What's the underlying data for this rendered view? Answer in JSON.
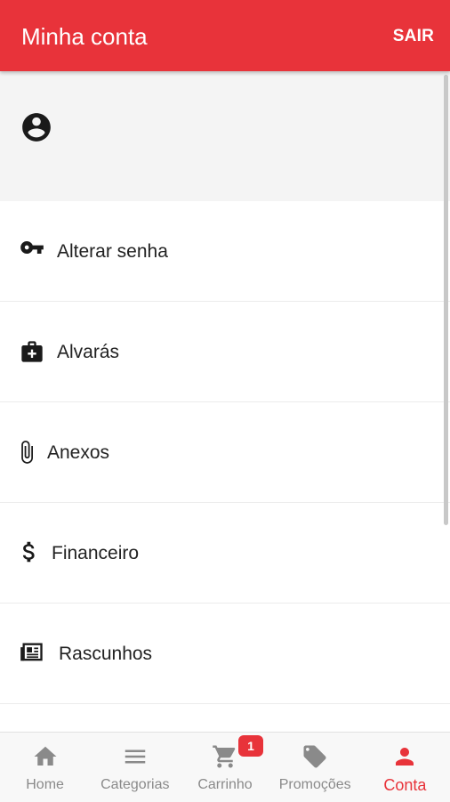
{
  "header": {
    "title": "Minha conta",
    "logout_label": "SAIR",
    "color": "#e8333a"
  },
  "profile": {
    "avatar_icon": "account-circle-icon"
  },
  "menu": {
    "items": [
      {
        "label": "Alterar senha",
        "icon": "key-icon"
      },
      {
        "label": "Alvarás",
        "icon": "medical-bag-icon"
      },
      {
        "label": "Anexos",
        "icon": "paperclip-icon"
      },
      {
        "label": "Financeiro",
        "icon": "dollar-icon"
      },
      {
        "label": "Rascunhos",
        "icon": "newspaper-icon"
      }
    ]
  },
  "bottom_nav": {
    "items": [
      {
        "label": "Home",
        "icon": "home-icon"
      },
      {
        "label": "Categorias",
        "icon": "menu-icon"
      },
      {
        "label": "Carrinho",
        "icon": "cart-icon"
      },
      {
        "label": "Promoções",
        "icon": "tags-icon"
      },
      {
        "label": "Conta",
        "icon": "person-icon"
      }
    ],
    "active": "Conta",
    "cart_badge": "1",
    "active_color": "#e8333a",
    "inactive_color": "#8a8a8a"
  }
}
